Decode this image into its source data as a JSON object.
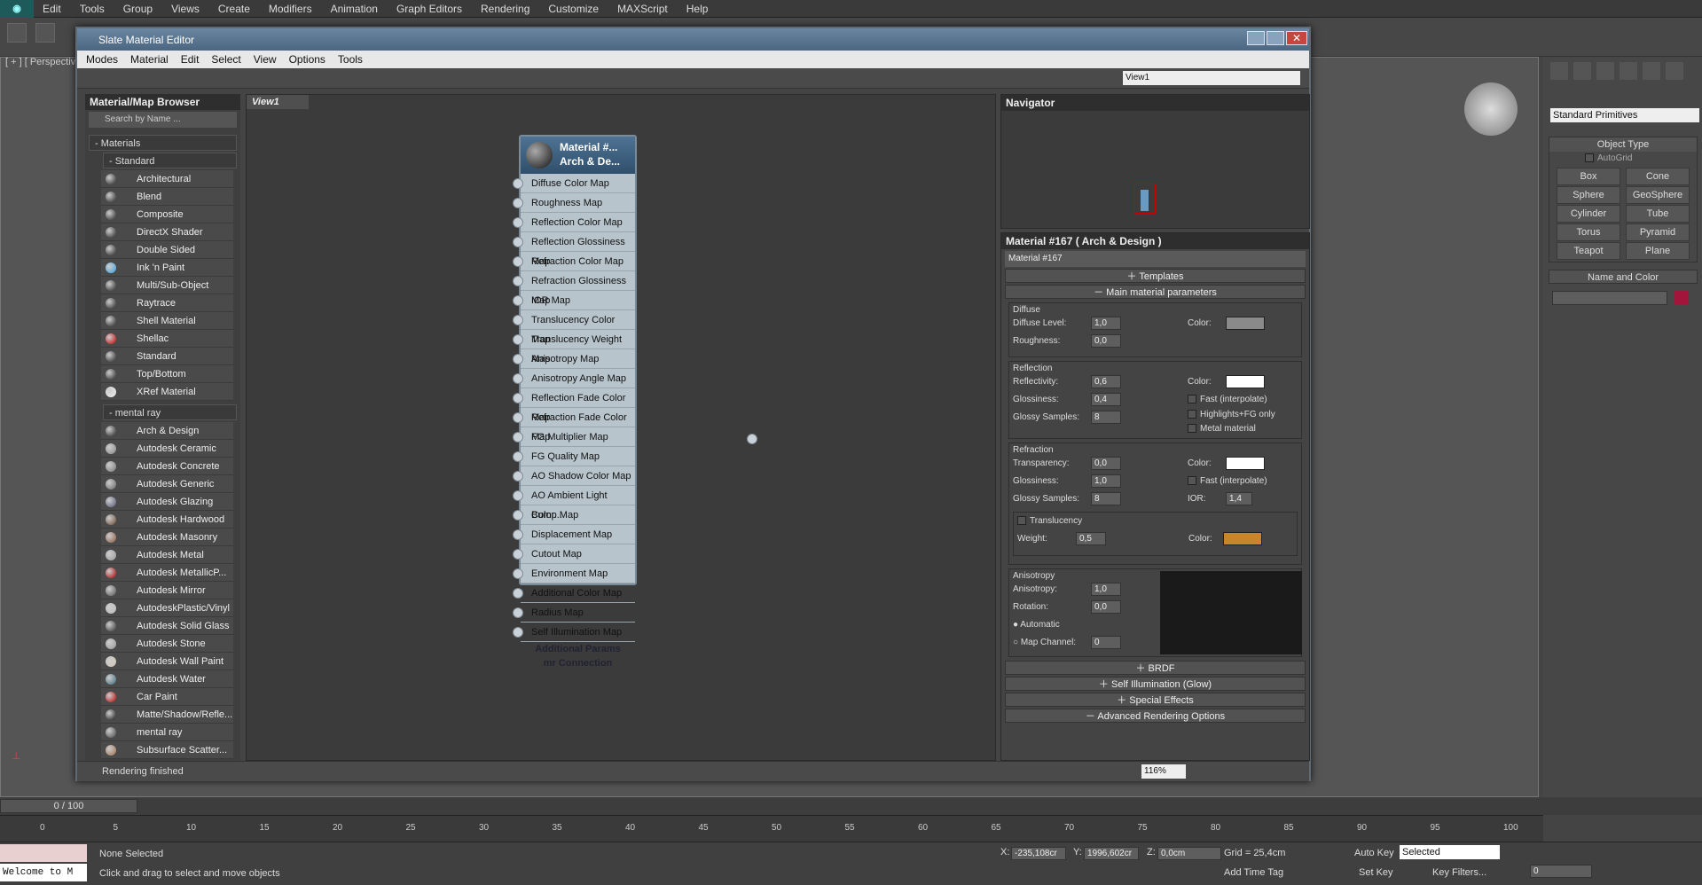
{
  "main_menu": [
    "Edit",
    "Tools",
    "Group",
    "Views",
    "Create",
    "Modifiers",
    "Animation",
    "Graph Editors",
    "Rendering",
    "Customize",
    "MAXScript",
    "Help"
  ],
  "viewport_label": "[ + ] [ Perspective",
  "window": {
    "title": "Slate Material Editor",
    "menu": [
      "Modes",
      "Material",
      "Edit",
      "Select",
      "View",
      "Options",
      "Tools"
    ],
    "view_dropdown": "View1",
    "view_tab": "View1",
    "status": "Rendering finished",
    "zoom": "116%"
  },
  "browser": {
    "title": "Material/Map Browser",
    "search_placeholder": "Search by Name ...",
    "materials_label": "- Materials",
    "standard_label": "- Standard",
    "standard_items": [
      {
        "label": "Architectural",
        "color": "#222"
      },
      {
        "label": "Blend",
        "color": "#222"
      },
      {
        "label": "Composite",
        "color": "#222"
      },
      {
        "label": "DirectX Shader",
        "color": "#222"
      },
      {
        "label": "Double Sided",
        "color": "#222"
      },
      {
        "label": "Ink 'n Paint",
        "color": "#3aa0e0"
      },
      {
        "label": "Multi/Sub-Object",
        "color": "#222"
      },
      {
        "label": "Raytrace",
        "color": "#222"
      },
      {
        "label": "Shell Material",
        "color": "#222"
      },
      {
        "label": "Shellac",
        "color": "#c00000"
      },
      {
        "label": "Standard",
        "color": "#222"
      },
      {
        "label": "Top/Bottom",
        "color": "#222"
      },
      {
        "label": "XRef Material",
        "color": "#eee"
      }
    ],
    "mentalray_label": "- mental ray",
    "mentalray_items": [
      {
        "label": "Arch & Design",
        "color": "#222"
      },
      {
        "label": "Autodesk Ceramic",
        "color": "#888"
      },
      {
        "label": "Autodesk Concrete",
        "color": "#777"
      },
      {
        "label": "Autodesk Generic",
        "color": "#666"
      },
      {
        "label": "Autodesk Glazing",
        "color": "#557"
      },
      {
        "label": "Autodesk Hardwood",
        "color": "#6a4a32"
      },
      {
        "label": "Autodesk Masonry C...",
        "color": "#8a5a40"
      },
      {
        "label": "Autodesk Metal",
        "color": "#999"
      },
      {
        "label": "Autodesk MetallicP...",
        "color": "#a00"
      },
      {
        "label": "Autodesk Mirror",
        "color": "#555"
      },
      {
        "label": "AutodeskPlastic/Vinyl",
        "color": "#bbb"
      },
      {
        "label": "Autodesk Solid Glass",
        "color": "#333"
      },
      {
        "label": "Autodesk Stone",
        "color": "#999"
      },
      {
        "label": "Autodesk Wall Paint",
        "color": "#cfc5b5"
      },
      {
        "label": "Autodesk Water",
        "color": "#3a6a7a"
      },
      {
        "label": "Car Paint",
        "color": "#b00"
      },
      {
        "label": "Matte/Shadow/Refle...",
        "color": "#111"
      },
      {
        "label": "mental ray",
        "color": "#444"
      },
      {
        "label": "Subsurface Scatter...",
        "color": "#a07050"
      }
    ]
  },
  "node": {
    "title1": "Material #...",
    "title2": "Arch & De...",
    "slots": [
      "Diffuse Color Map",
      "Roughness Map",
      "Reflection Color Map",
      "Reflection Glossiness Map",
      "Refraction Color Map",
      "Refraction Glossiness Map",
      "IOR Map",
      "Translucency Color Map",
      "Translucency Weight Map",
      "Anisotropy Map",
      "Anisotropy Angle Map",
      "Reflection Fade Color Map",
      "Refraction Fade Color Map",
      "FG Multiplier Map",
      "FG Quality Map",
      "AO Shadow Color Map",
      "AO Ambient Light Color...",
      "Bump Map",
      "Displacement Map",
      "Cutout Map",
      "Environment Map",
      "Additional Color Map",
      "Radius Map",
      "Self Illumination Map"
    ],
    "footer1": "Additional Params",
    "footer2": "mr Connection"
  },
  "navigator": {
    "title": "Navigator"
  },
  "params": {
    "title": "Material #167  ( Arch & Design )",
    "name": "Material #167",
    "templates": "Templates",
    "main": "Main material parameters",
    "diffuse": {
      "label": "Diffuse",
      "level_label": "Diffuse Level:",
      "level": "1,0",
      "rough_label": "Roughness:",
      "rough": "0,0",
      "color_label": "Color:",
      "color": "#8a8a8a"
    },
    "reflection": {
      "label": "Reflection",
      "refl_label": "Reflectivity:",
      "refl": "0,6",
      "gloss_label": "Glossiness:",
      "gloss": "0,4",
      "samples_label": "Glossy Samples:",
      "samples": "8",
      "color_label": "Color:",
      "color": "#ffffff",
      "fast": "Fast (interpolate)",
      "highlights": "Highlights+FG only",
      "metal": "Metal material"
    },
    "refraction": {
      "label": "Refraction",
      "trans_label": "Transparency:",
      "trans": "0,0",
      "gloss_label": "Glossiness:",
      "gloss": "1,0",
      "samples_label": "Glossy Samples:",
      "samples": "8",
      "color_label": "Color:",
      "color": "#ffffff",
      "fast": "Fast (interpolate)",
      "ior_label": "IOR:",
      "ior": "1,4",
      "translucency": "Translucency",
      "weight_label": "Weight:",
      "weight": "0,5",
      "tcolor_label": "Color:",
      "tcolor": "#c8862a"
    },
    "anisotropy": {
      "label": "Anisotropy",
      "aniso_label": "Anisotropy:",
      "aniso": "1,0",
      "rot_label": "Rotation:",
      "rot": "0,0",
      "auto": "Automatic",
      "map": "Map Channel:",
      "map_val": "0"
    },
    "rollouts": [
      "BRDF",
      "Self Illumination (Glow)",
      "Special Effects",
      "Advanced Rendering Options"
    ]
  },
  "cmdpanel": {
    "dropdown": "Standard Primitives",
    "object_type": "Object Type",
    "autogrid": "AutoGrid",
    "buttons": [
      "Box",
      "Cone",
      "Sphere",
      "GeoSphere",
      "Cylinder",
      "Tube",
      "Torus",
      "Pyramid",
      "Teapot",
      "Plane"
    ],
    "name_color": "Name and Color"
  },
  "timeline": {
    "counter": "0 / 100",
    "ticks": [
      "0",
      "5",
      "10",
      "15",
      "20",
      "25",
      "30",
      "35",
      "40",
      "45",
      "50",
      "55",
      "60",
      "65",
      "70",
      "75",
      "80",
      "85",
      "90",
      "95",
      "100"
    ]
  },
  "statusbar": {
    "none_selected": "None Selected",
    "hint": "Click and drag to select and move objects",
    "welcome": "Welcome to M",
    "x": "-235,108cr",
    "y": "1996,602cr",
    "z": "0,0cm",
    "grid": "Grid = 25,4cm",
    "autokey": "Auto Key",
    "selected": "Selected",
    "setkey": "Set Key",
    "keyfilters": "Key Filters...",
    "addtimetag": "Add Time Tag",
    "frame": "0"
  }
}
